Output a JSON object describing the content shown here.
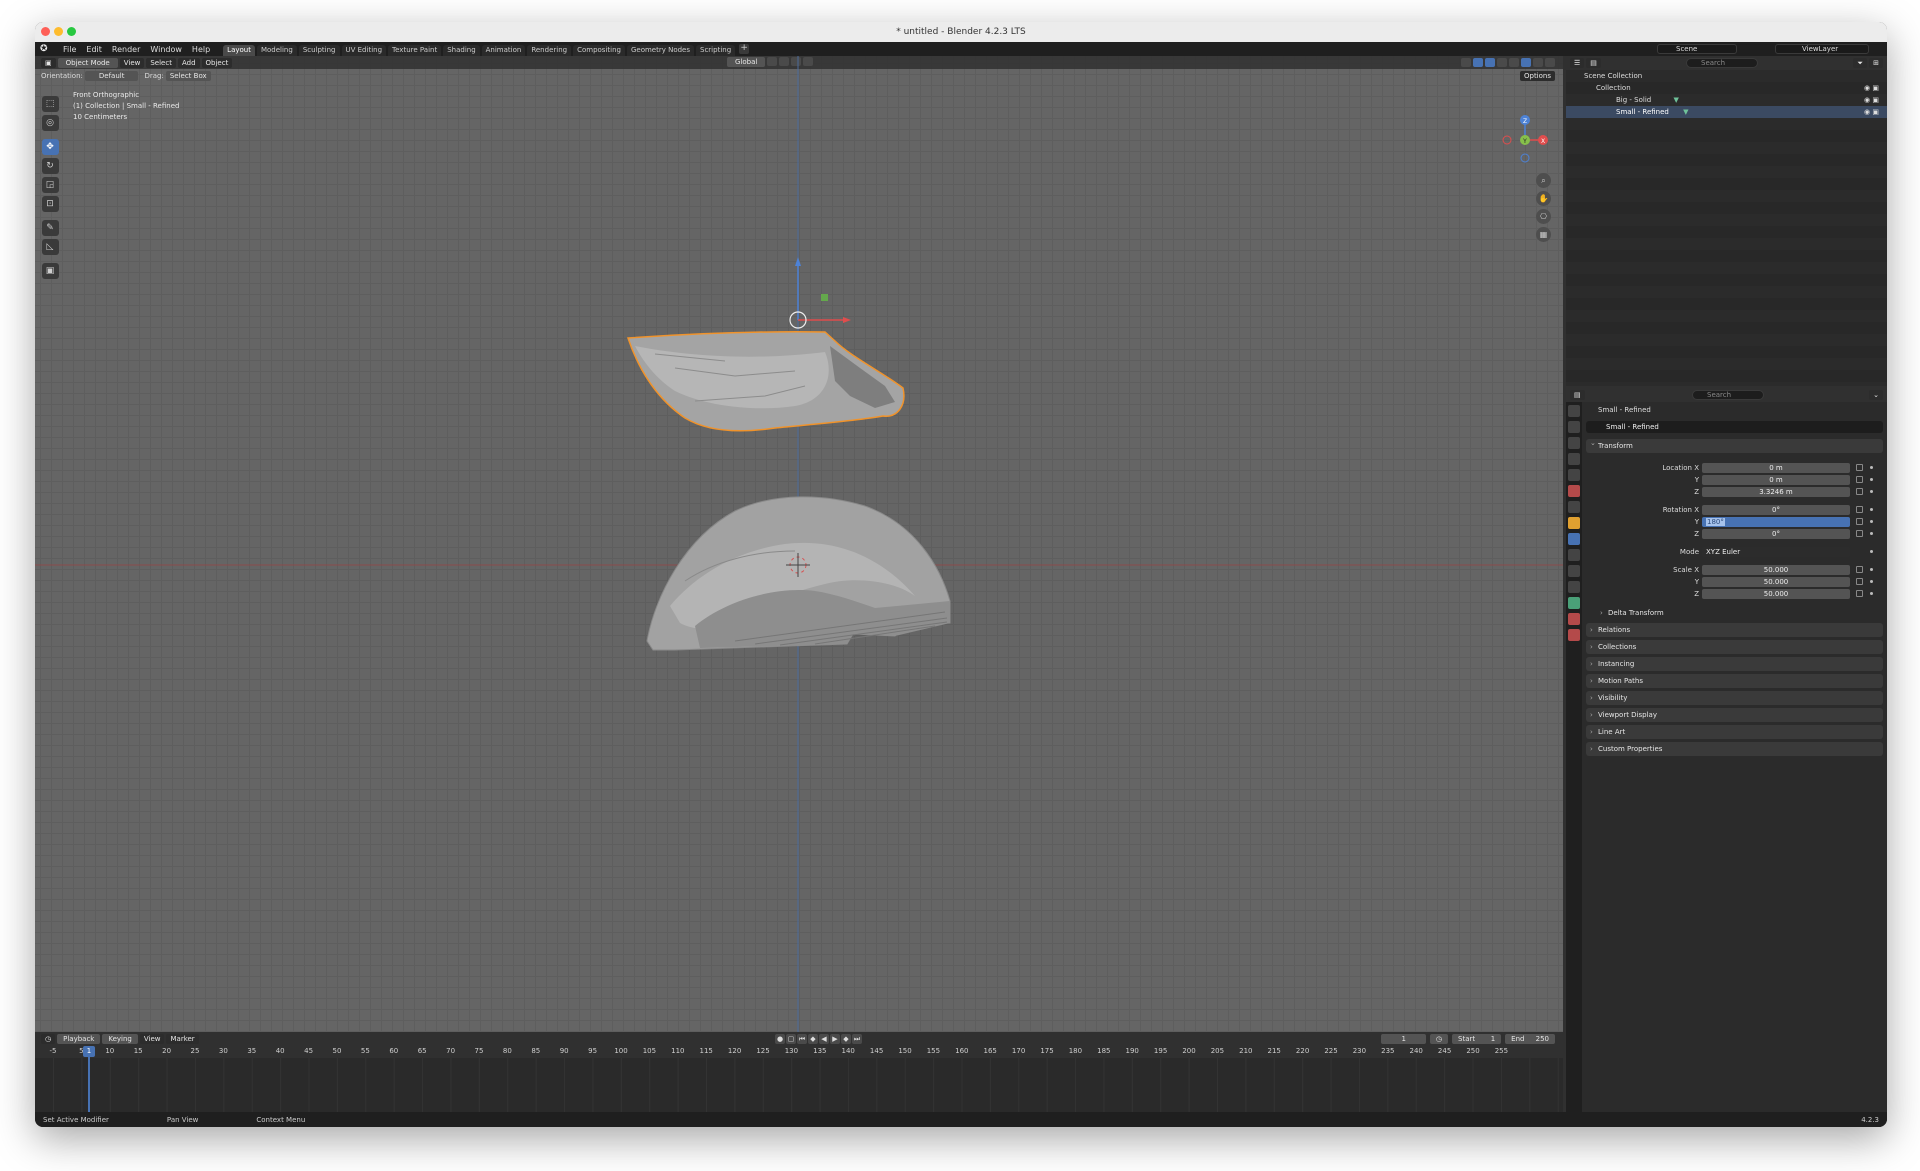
{
  "window": {
    "title": "* untitled - Blender 4.2.3 LTS"
  },
  "menu": [
    "File",
    "Edit",
    "Render",
    "Window",
    "Help"
  ],
  "workspaces": [
    "Layout",
    "Modeling",
    "Sculpting",
    "UV Editing",
    "Texture Paint",
    "Shading",
    "Animation",
    "Rendering",
    "Compositing",
    "Geometry Nodes",
    "Scripting"
  ],
  "workspace_add": "+",
  "scene": "Scene",
  "view_layer": "ViewLayer",
  "viewport": {
    "mode": "Object Mode",
    "header_menus": [
      "View",
      "Select",
      "Add",
      "Object"
    ],
    "orientation_label": "Orientation:",
    "orientation_value": "Default",
    "drag_label": "Drag:",
    "drag_value": "Select Box",
    "transform_orientation": "Global",
    "options": "Options",
    "overlay_lines": [
      "Front Orthographic",
      "(1) Collection | Small - Refined",
      "10 Centimeters"
    ],
    "gizmo_axes": [
      "Z",
      "Y",
      "X"
    ]
  },
  "timeline": {
    "menus": [
      "Playback",
      "Keying",
      "View",
      "Marker"
    ],
    "current_frame": "1",
    "start_label": "Start",
    "start": "1",
    "end_label": "End",
    "end": "250",
    "ruler": [
      "-5",
      "1",
      "5",
      "10",
      "15",
      "20",
      "25",
      "30",
      "35",
      "40",
      "45",
      "50",
      "55",
      "60",
      "65",
      "70",
      "75",
      "80",
      "85",
      "90",
      "95",
      "100",
      "105",
      "110",
      "115",
      "120",
      "125",
      "130",
      "135",
      "140",
      "145",
      "150",
      "155",
      "160",
      "165",
      "170",
      "175",
      "180",
      "185",
      "190",
      "195",
      "200",
      "205",
      "210",
      "215",
      "220",
      "225",
      "230",
      "235",
      "240",
      "245",
      "250",
      "255"
    ]
  },
  "statusbar": {
    "items": [
      "Set Active Modifier",
      "Pan View",
      "Context Menu"
    ],
    "version": "4.2.3"
  },
  "outliner": {
    "search_placeholder": "Search",
    "rows": [
      {
        "label": "Scene Collection",
        "indent": 0
      },
      {
        "label": "Collection",
        "indent": 1
      },
      {
        "label": "Big - Solid",
        "indent": 2
      },
      {
        "label": "Small - Refined",
        "indent": 2,
        "selected": true
      }
    ]
  },
  "properties": {
    "search_placeholder": "Search",
    "object_breadcrumb": "Small - Refined",
    "object_name": "Small - Refined",
    "transform_title": "Transform",
    "location": {
      "label": "Location X",
      "x": "0 m",
      "y": "0 m",
      "z": "3.3246 m"
    },
    "rotation": {
      "label": "Rotation X",
      "x": "0°",
      "y": "180°",
      "z": "0°"
    },
    "mode_label": "Mode",
    "mode_value": "XYZ Euler",
    "scale": {
      "label": "Scale X",
      "x": "50.000",
      "y": "50.000",
      "z": "50.000"
    },
    "axis_y": "Y",
    "axis_z": "Z",
    "delta": "Delta Transform",
    "panels": [
      "Relations",
      "Collections",
      "Instancing",
      "Motion Paths",
      "Visibility",
      "Viewport Display",
      "Line Art",
      "Custom Properties"
    ]
  }
}
